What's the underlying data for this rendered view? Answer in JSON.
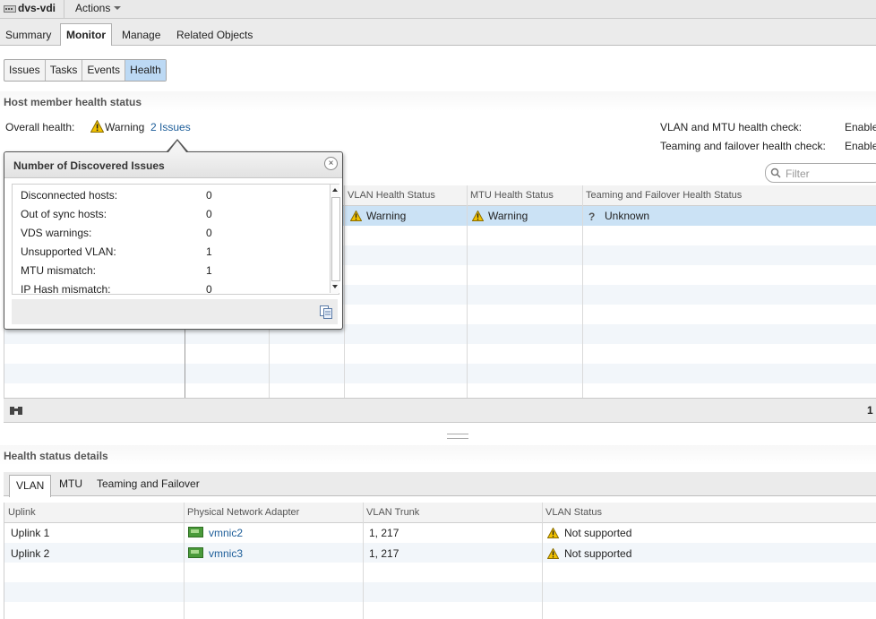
{
  "window": {
    "object_name": "dvs-vdi",
    "actions_label": "Actions"
  },
  "main_tabs": [
    "Summary",
    "Monitor",
    "Manage",
    "Related Objects"
  ],
  "sub_tabs": [
    "Issues",
    "Tasks",
    "Events",
    "Health"
  ],
  "host_section": {
    "title": "Host member health status",
    "overall_label": "Overall health:",
    "overall_status": "Warning",
    "issues_link": "2 Issues",
    "checks": [
      {
        "label": "VLAN and MTU health check:",
        "value": "Enable"
      },
      {
        "label": "Teaming and failover health check:",
        "value": "Enable"
      }
    ],
    "filter_placeholder": "Filter"
  },
  "host_grid": {
    "columns": [
      "VLAN Health Status",
      "MTU Health Status",
      "Teaming and Failover Health Status"
    ],
    "rows": [
      {
        "vlan": "Warning",
        "mtu": "Warning",
        "teaming": "Unknown"
      }
    ],
    "footer_count": "1"
  },
  "popup": {
    "title": "Number of Discovered Issues",
    "items": [
      {
        "label": "Disconnected hosts:",
        "value": "0"
      },
      {
        "label": "Out of sync hosts:",
        "value": "0"
      },
      {
        "label": "VDS warnings:",
        "value": "0"
      },
      {
        "label": "Unsupported VLAN:",
        "value": "1"
      },
      {
        "label": "MTU mismatch:",
        "value": "1"
      },
      {
        "label": "IP Hash mismatch:",
        "value": "0"
      }
    ]
  },
  "details_section": {
    "title": "Health status details",
    "tabs": [
      "VLAN",
      "MTU",
      "Teaming and Failover"
    ],
    "columns": [
      "Uplink",
      "Physical Network Adapter",
      "VLAN Trunk",
      "VLAN Status"
    ],
    "rows": [
      {
        "uplink": "Uplink 1",
        "adapter": "vmnic2",
        "trunk": "1, 217",
        "status": "Not supported"
      },
      {
        "uplink": "Uplink 2",
        "adapter": "vmnic3",
        "trunk": "1, 217",
        "status": "Not supported"
      }
    ]
  },
  "colors": {
    "selected_row": "#cbe2f5",
    "link": "#1c5d99",
    "warning": "#f2c200",
    "active_subtab": "#bcd9f4"
  }
}
